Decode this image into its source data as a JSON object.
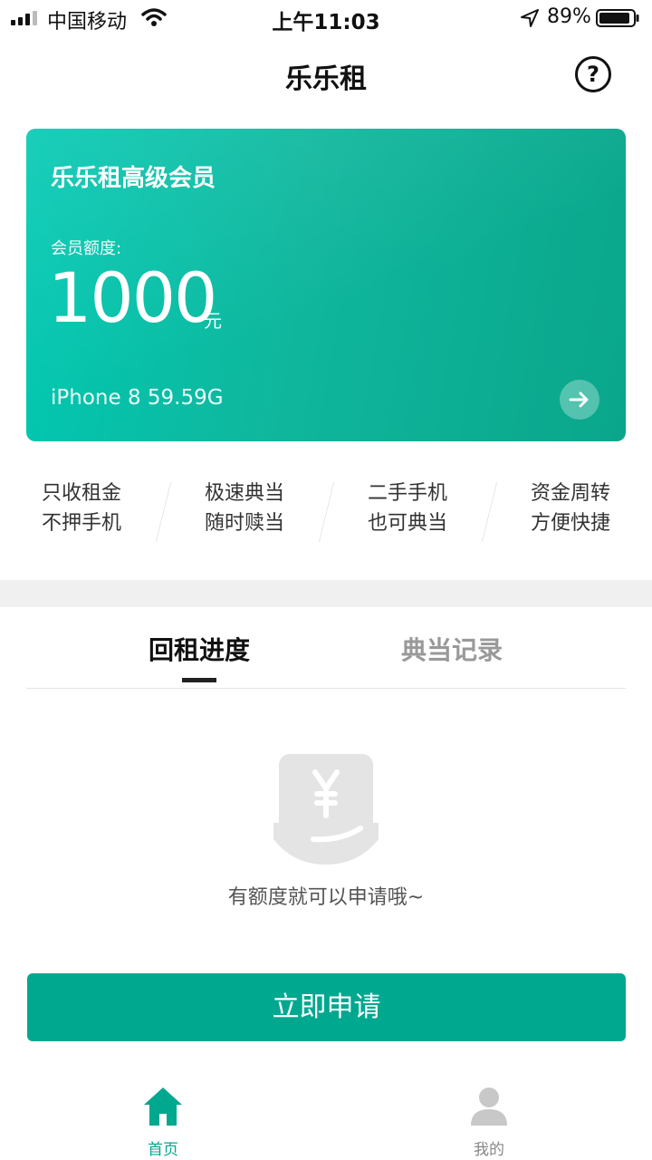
{
  "status_bar": {
    "carrier": "中国移动",
    "time": "上午11:03",
    "battery_percent": "89%"
  },
  "header": {
    "title": "乐乐租",
    "help_label": "?"
  },
  "member_card": {
    "title": "乐乐租高级会员",
    "quota_label": "会员额度:",
    "quota_value": "1000",
    "quota_unit": "元",
    "device_info": "iPhone 8  59.59G",
    "gradient_start": "#00c9b3",
    "gradient_end": "#0aa68b"
  },
  "features": [
    {
      "line1": "只收租金",
      "line2": "不押手机"
    },
    {
      "line1": "极速典当",
      "line2": "随时赎当"
    },
    {
      "line1": "二手手机",
      "line2": "也可典当"
    },
    {
      "line1": "资金周转",
      "line2": "方便快捷"
    }
  ],
  "tabs": [
    {
      "label": "回租进度",
      "active": true
    },
    {
      "label": "典当记录",
      "active": false
    }
  ],
  "empty_state": {
    "icon": "yuan-hand-icon",
    "text": "有额度就可以申请哦~"
  },
  "apply_button": {
    "label": "立即申请",
    "color": "#00a88f"
  },
  "bottom_nav": [
    {
      "label": "首页",
      "icon": "home-icon",
      "active": true
    },
    {
      "label": "我的",
      "icon": "user-icon",
      "active": false
    }
  ],
  "colors": {
    "accent": "#00a88f",
    "inactive": "#888888"
  }
}
